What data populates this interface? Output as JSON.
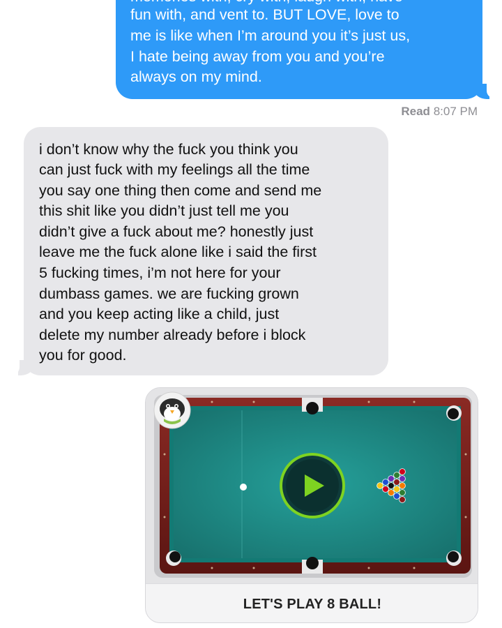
{
  "messages": {
    "outgoing": {
      "lines": [
        "memories with, cry with, laugh with, have",
        "fun with, and vent to. BUT LOVE, love to",
        "me is like when I’m around you it’s just us,",
        "I hate being away from you and you’re",
        "always on my mind."
      ],
      "bubble_color": "#2e9af8"
    },
    "read_receipt": {
      "label": "Read",
      "time": "8:07 PM"
    },
    "incoming": {
      "lines": [
        "i don’t know why the fuck you think you",
        "can just fuck with my feelings all the time",
        "you say one thing then come and send me",
        "this shit like you didn’t just tell me you",
        "didn’t give a fuck about me? honestly just",
        "leave me the fuck alone like i said the first",
        "5 fucking times, i’m not here for your",
        "dumbass games. we are fucking grown",
        "and you keep acting like a child, just",
        "delete my number already before i block",
        "you for good."
      ],
      "bubble_color": "#e7e7ea"
    }
  },
  "game_card": {
    "caption": "LET'S PLAY 8 BALL!",
    "icons": {
      "app": "penguin-app-icon",
      "play": "play-icon"
    },
    "colors": {
      "felt": "#1f8f8a",
      "rail_wood": "#6e1d1a",
      "play_ring": "#7ed321"
    }
  }
}
